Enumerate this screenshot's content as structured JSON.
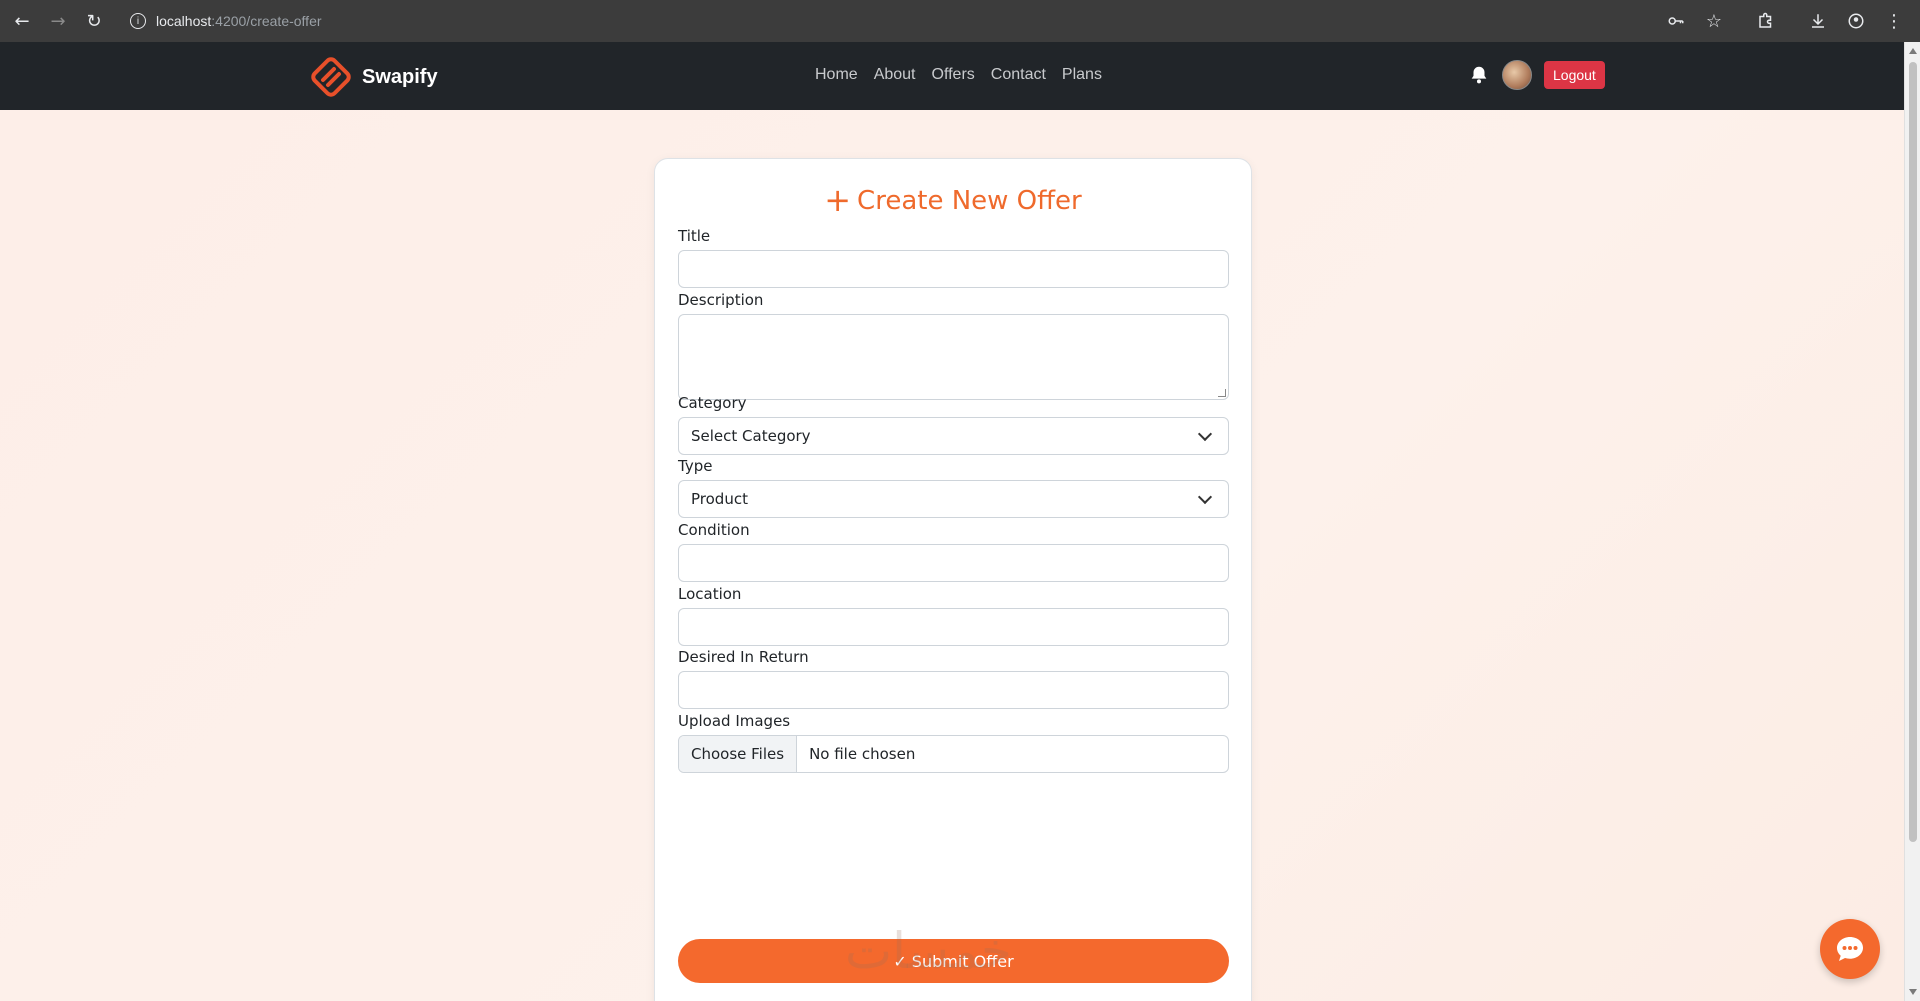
{
  "browser": {
    "url_host": "localhost",
    "url_path": ":4200/create-offer",
    "icons": [
      "back-icon",
      "forward-icon",
      "reload-icon",
      "site-info-icon",
      "password-key-icon",
      "bookmark-star-icon",
      "extensions-icon",
      "download-icon",
      "profile-icon",
      "menu-icon"
    ]
  },
  "navbar": {
    "brand": "Swapify",
    "links": [
      "Home",
      "About",
      "Offers",
      "Contact",
      "Plans"
    ],
    "logout_label": "Logout",
    "accent": "#dc3545"
  },
  "form": {
    "title": "Create New Offer",
    "fields": {
      "title_label": "Title",
      "description_label": "Description",
      "category_label": "Category",
      "category_value": "Select Category",
      "type_label": "Type",
      "type_value": "Product",
      "condition_label": "Condition",
      "location_label": "Location",
      "desired_label": "Desired In Return",
      "upload_label": "Upload Images",
      "choose_files": "Choose Files",
      "file_status": "No file chosen"
    },
    "submit_label": "✓ Submit Offer",
    "accent": "#f4692d"
  },
  "watermark": "خمسات"
}
